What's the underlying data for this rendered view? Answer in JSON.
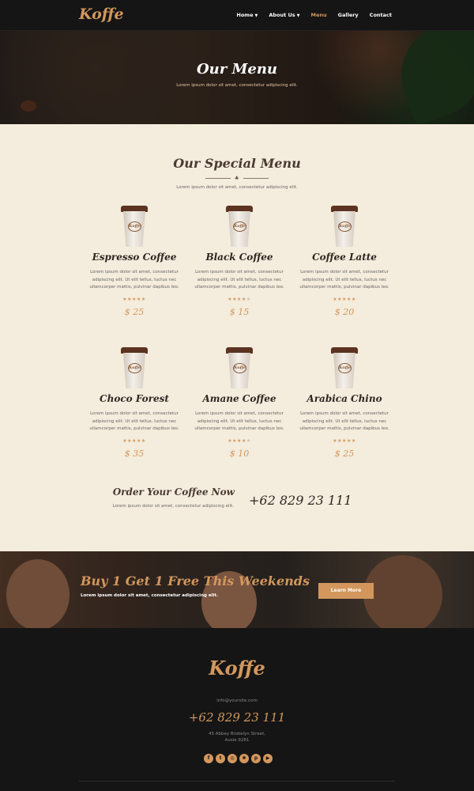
{
  "header": {
    "logo": "Koffe",
    "nav": [
      {
        "label": "Home",
        "dropdown": true
      },
      {
        "label": "About Us",
        "dropdown": true
      },
      {
        "label": "Menu",
        "dropdown": false,
        "active": true
      },
      {
        "label": "Gallery",
        "dropdown": false
      },
      {
        "label": "Contact",
        "dropdown": false
      }
    ]
  },
  "hero": {
    "title": "Our Menu",
    "subtitle": "Lorem ipsum dolor sit amet, consectetur adipiscing elit."
  },
  "menu": {
    "title": "Our Special Menu",
    "subtitle": "Lorem ipsum dolor sit amet, consectetur adipiscing elit.",
    "cup_label": "Koffe",
    "items": [
      {
        "name": "Espresso Coffee",
        "desc": "Lorem ipsum dolor sit amet, consectetur adipiscing elit. Ut elit tellus, luctus nec ullamcorper mattis, pulvinar dapibus leo.",
        "rating": 5,
        "price": "$ 25"
      },
      {
        "name": "Black Coffee",
        "desc": "Lorem ipsum dolor sit amet, consectetur adipiscing elit. Ut elit tellus, luctus nec ullamcorper mattis, pulvinar dapibus leo.",
        "rating": 4,
        "price": "$ 15"
      },
      {
        "name": "Coffee Latte",
        "desc": "Lorem ipsum dolor sit amet, consectetur adipiscing elit. Ut elit tellus, luctus nec ullamcorper mattis, pulvinar dapibus leo.",
        "rating": 4.5,
        "price": "$ 20"
      },
      {
        "name": "Choco Forest",
        "desc": "Lorem ipsum dolor sit amet, consectetur adipiscing elit. Ut elit tellus, luctus nec ullamcorper mattis, pulvinar dapibus leo.",
        "rating": 5,
        "price": "$ 35"
      },
      {
        "name": "Amane Coffee",
        "desc": "Lorem ipsum dolor sit amet, consectetur adipiscing elit. Ut elit tellus, luctus nec ullamcorper mattis, pulvinar dapibus leo.",
        "rating": 4,
        "price": "$ 10"
      },
      {
        "name": "Arabica Chino",
        "desc": "Lorem ipsum dolor sit amet, consectetur adipiscing elit. Ut elit tellus, luctus nec ullamcorper mattis, pulvinar dapibus leo.",
        "rating": 4.5,
        "price": "$ 25"
      }
    ]
  },
  "order": {
    "title": "Order Your Coffee Now",
    "subtitle": "Lorem ipsum dolor sit amet, consectetur adipiscing elit.",
    "phone": "+62 829 23 111"
  },
  "promo": {
    "title": "Buy 1 Get 1 Free This Weekends",
    "subtitle": "Lorem ipsum dolor sit amet, consectetur adipiscing elit.",
    "button": "Learn More"
  },
  "footer": {
    "logo": "Koffe",
    "email": "info@yoursite.com",
    "phone": "+62 829 23 111",
    "address_line1": "45 Abbey Brokelyn Street,",
    "address_line2": "Ausie 9281",
    "social": [
      "facebook-icon",
      "twitter-icon",
      "instagram-icon",
      "yelp-icon",
      "pinterest-icon",
      "youtube-icon"
    ]
  },
  "colors": {
    "accent": "#d3975d",
    "dark": "#151515",
    "cream": "#f4ecdc",
    "heading": "#4a3a32"
  }
}
